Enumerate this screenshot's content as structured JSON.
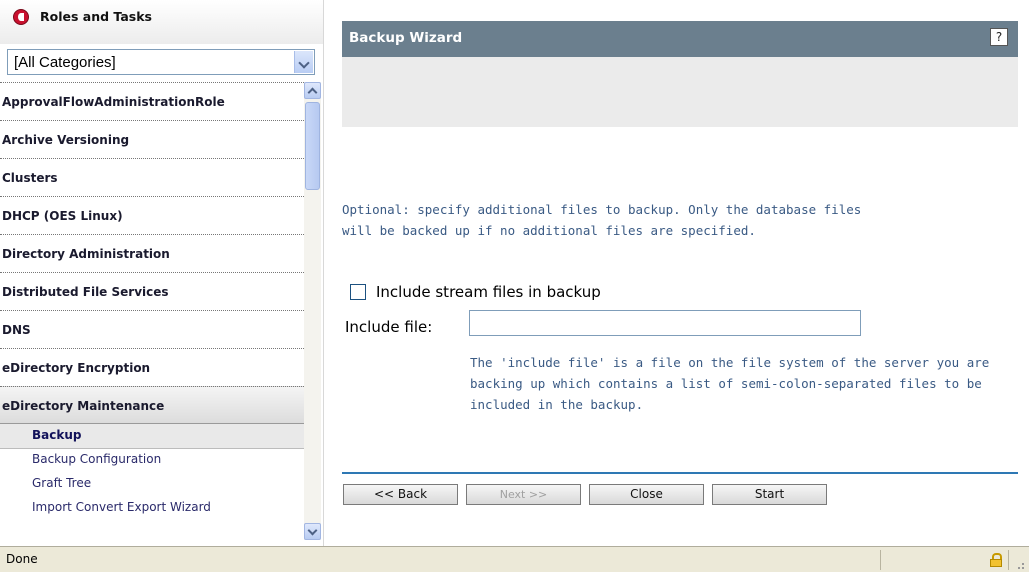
{
  "left_panel": {
    "title": "Roles and Tasks",
    "category_select": "[All Categories]",
    "categories": [
      "ApprovalFlowAdministrationRole",
      "Archive Versioning",
      "Clusters",
      "DHCP (OES Linux)",
      "Directory Administration",
      "Distributed File Services",
      "DNS",
      "eDirectory Encryption",
      "eDirectory Maintenance"
    ],
    "tasks": [
      "Backup",
      "Backup Configuration",
      "Graft Tree",
      "Import Convert Export Wizard"
    ],
    "selected_task": "Backup"
  },
  "wizard": {
    "title": "Backup Wizard",
    "help_icon": "?",
    "optional_text_1": "Optional: specify additional files to backup. Only the database files",
    "optional_text_2": "will be backed up if no additional files are specified.",
    "stream_checkbox_label": "Include stream files in backup",
    "stream_checkbox_checked": false,
    "include_file_label": "Include file:",
    "include_file_value": "",
    "include_help_1": "The 'include file' is a file on the file system of the server you are",
    "include_help_2": "backing up which contains a list of semi-colon-separated files to be",
    "include_help_3": "included in the backup.",
    "buttons": {
      "back": "<< Back",
      "next": "Next >>",
      "close": "Close",
      "start": "Start"
    }
  },
  "status_bar": {
    "text": "Done"
  },
  "colors": {
    "header_bg": "#6b7f8e",
    "separator": "#2e78b4",
    "body_text": "#3a5a84"
  }
}
